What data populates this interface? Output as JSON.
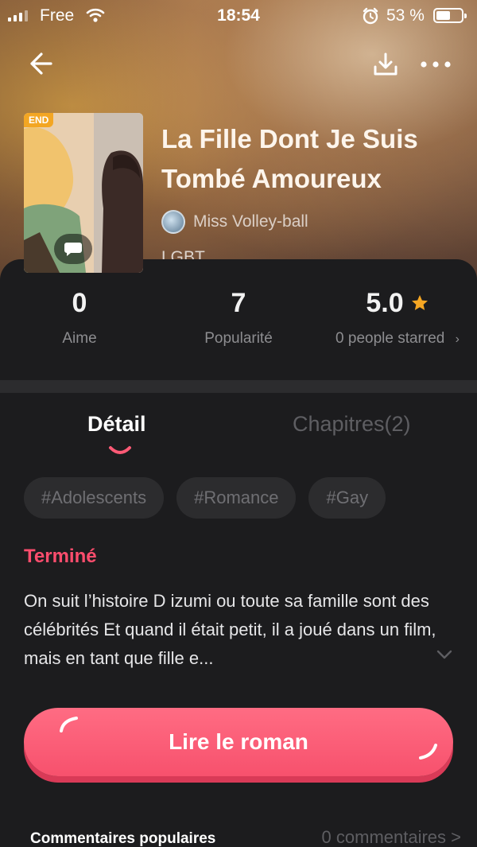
{
  "status_bar": {
    "carrier": "Free",
    "time": "18:54",
    "battery": "53 %"
  },
  "book": {
    "title": "La Fille Dont Je Suis Tombé Amoureux",
    "author": "Miss Volley-ball",
    "genre": "LGBT",
    "cover_badge": "END"
  },
  "stats": {
    "likes": "0",
    "likes_label": "Aime",
    "popularity": "7",
    "popularity_label": "Popularité",
    "rating": "5.0",
    "rating_label": "0 people starred"
  },
  "tabs": [
    {
      "label": "Détail",
      "active": true
    },
    {
      "label": "Chapitres(2)",
      "active": false
    }
  ],
  "tags": [
    "#Adolescents",
    "#Romance",
    "#Gay"
  ],
  "status": "Terminé",
  "synopsis": "On suit l’histoire D izumi ou toute sa famille sont des célébrités  Et quand il était petit, il a joué dans un film, mais en tant que fille e...",
  "read_button": "Lire le roman",
  "comments": {
    "title": "Commentaires populaires",
    "count": "0 commentaires >"
  },
  "colors": {
    "accent": "#ff5a76",
    "status_red": "#ff4d6d",
    "star": "#f5a623",
    "badge_end": "#f3a623",
    "sheet_bg": "#1c1c1e"
  },
  "icons": {
    "back": "arrow-left-icon",
    "download": "download-icon",
    "more": "more-icon",
    "star": "star-icon",
    "chevron_right": "chevron-right-icon",
    "chevron_down": "chevron-down-icon"
  }
}
